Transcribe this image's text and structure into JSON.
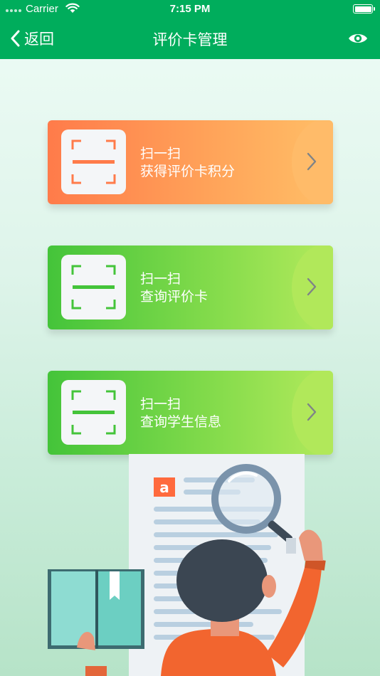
{
  "status_bar": {
    "carrier": "Carrier",
    "time": "7:15 PM"
  },
  "nav": {
    "back_label": "返回",
    "title": "评价卡管理"
  },
  "cards": [
    {
      "line1": "扫一扫",
      "line2": "获得评价卡积分",
      "accent": "#ff7b4a"
    },
    {
      "line1": "扫一扫",
      "line2": "查询评价卡",
      "accent": "#44c43a"
    },
    {
      "line1": "扫一扫",
      "line2": "查询学生信息",
      "accent": "#44c43a"
    }
  ],
  "illustration": {
    "badge_letter": "a"
  },
  "colors": {
    "header": "#00ad5c",
    "orange": "#ff7b4a",
    "green": "#44c43a"
  }
}
